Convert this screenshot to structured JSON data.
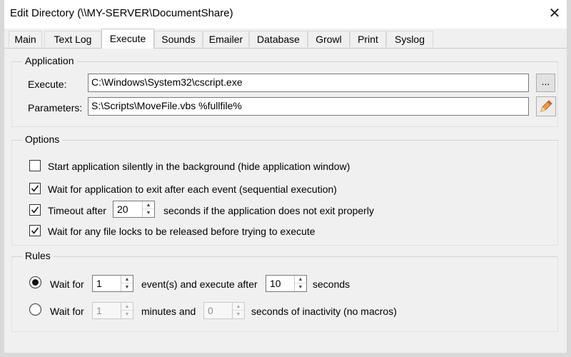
{
  "window": {
    "title": "Edit Directory (\\\\MY-SERVER\\DocumentShare)",
    "close_glyph": "✕"
  },
  "tabs": [
    {
      "label": "Main"
    },
    {
      "label": "Text Log"
    },
    {
      "label": "Execute"
    },
    {
      "label": "Sounds"
    },
    {
      "label": "Emailer"
    },
    {
      "label": "Database"
    },
    {
      "label": "Growl"
    },
    {
      "label": "Print"
    },
    {
      "label": "Syslog"
    }
  ],
  "active_tab": "Execute",
  "application": {
    "group_label": "Application",
    "execute_label": "Execute:",
    "execute_value": "C:\\Windows\\System32\\cscript.exe",
    "browse_label": "...",
    "parameters_label": "Parameters:",
    "parameters_value": "S:\\Scripts\\MoveFile.vbs %fullfile%",
    "macro_icon": "pencil-icon"
  },
  "options": {
    "group_label": "Options",
    "silent": {
      "label": "Start application silently in the background (hide application window)",
      "checked": false
    },
    "wait_exit": {
      "label": "Wait for application to exit after each event (sequential execution)",
      "checked": true
    },
    "timeout": {
      "label": "Timeout after",
      "checked": true,
      "value": "20",
      "suffix": "seconds if the application does not exit properly"
    },
    "file_locks": {
      "label": "Wait for any file locks to be released before trying to execute",
      "checked": true
    }
  },
  "rules": {
    "group_label": "Rules",
    "rule1": {
      "selected": true,
      "prefix": "Wait for",
      "events": "1",
      "middle": "event(s) and execute after",
      "seconds": "10",
      "suffix": "seconds"
    },
    "rule2": {
      "selected": false,
      "prefix": "Wait for",
      "minutes": "1",
      "middle": "minutes and",
      "seconds": "0",
      "suffix": "seconds of inactivity (no macros)"
    }
  },
  "colors": {
    "pencil": "#f0a030",
    "accent": "#0078d7"
  }
}
